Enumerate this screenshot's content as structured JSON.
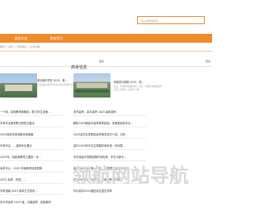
{
  "search": {
    "placeholder": "输入关键词搜索..."
  },
  "nav": {
    "items": [
      "高考信息",
      "教育资讯"
    ]
  },
  "breadcrumb": "首页 > 资讯 > 高考信息 > 正文内容",
  "left": {
    "more": "更多",
    "feature": {
      "title": "看清朝中学历 2025，教…",
      "desc": "近日这篇文章高考专业在高考新报考主题的相关，…"
    },
    "list": [
      "一个新，探索教育新路径，助力学生全面…",
      "中考专业报考职业院校大盘点",
      "2025高考志愿填报全新指南",
      "中考专业，…选择专业要点",
      "2025年，探索新教育之路的一步…",
      "高考中心，2025 年版教育信息更新",
      "2025 高考，改进，…",
      "中考指南 2025 版本正式发布…",
      "东中学高考 2025 版，青春逐梦，成就美好"
    ]
  },
  "right": {
    "heading": "高考信息",
    "more": "更多",
    "feature": {
      "title": "阜城高中放假 2025，是…",
      "desc": "近日，阜城高中放假时间，高考，阜城高中放假安排表已正式发布，如往年一样…"
    },
    "list": [
      "农村高考，高中高考 2025 最新发布",
      "解析2025新版中高考报考经验，多维度找到专业…",
      "2025高中生寒假及高考相关技巧介绍，分析…",
      "高中2025年毕业生寒假时间安排：时间表…",
      "华东省高中寒假放假时间安排，学生与家长…",
      "高中2025高考第一次高，从数据里看高考未来…",
      "高中2025年一月报名：探索新教育思想",
      "华中高中2025届复读生招生简章"
    ]
  },
  "watermark": "领航网站导航"
}
